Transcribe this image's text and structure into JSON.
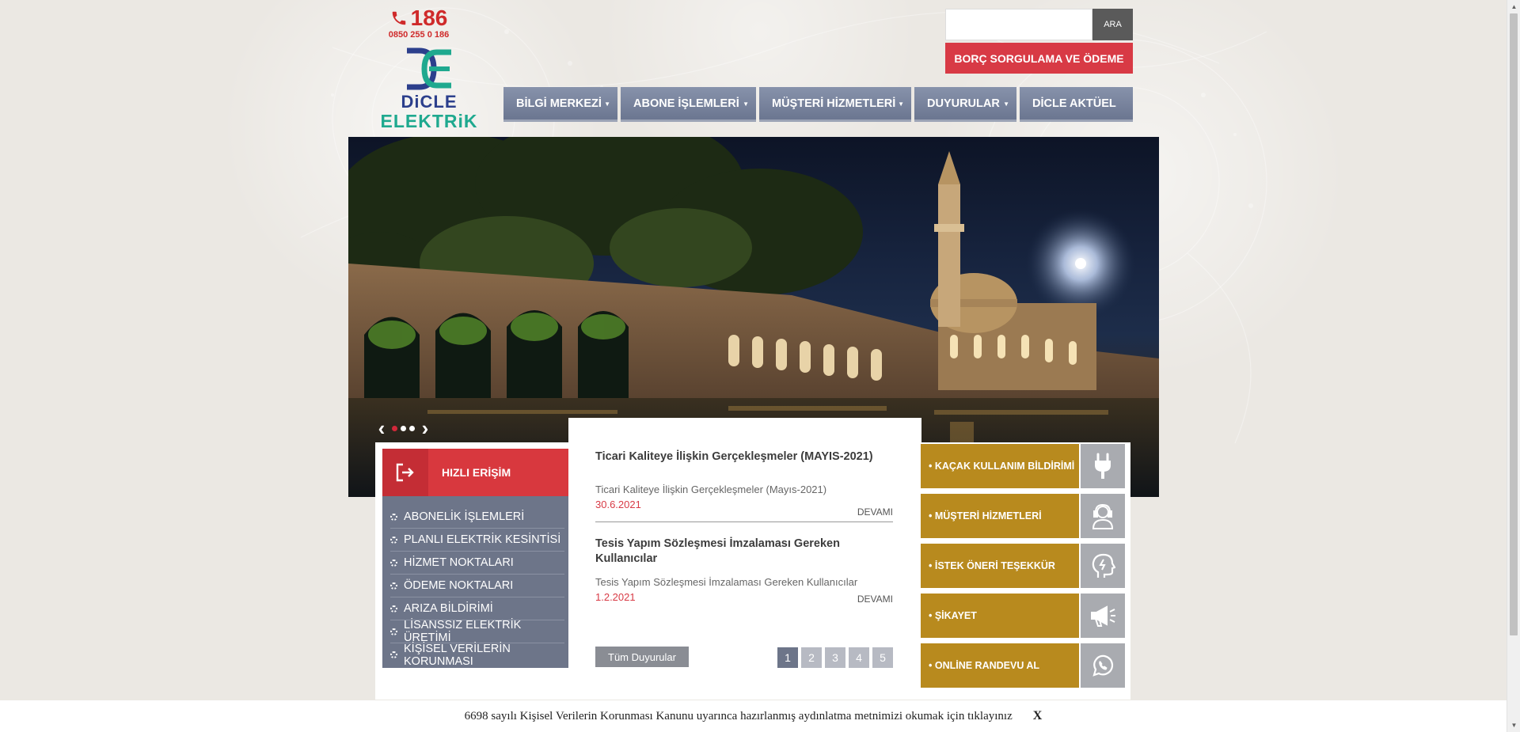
{
  "header": {
    "phone_short": "186",
    "phone_long": "0850 255 0 186",
    "logo_line1": "DiCLE",
    "logo_line2": "ELEKTRiK",
    "search_placeholder": "",
    "search_button": "ARA",
    "borc_button": "BORÇ SORGULAMA VE ÖDEME"
  },
  "nav": {
    "items": [
      {
        "label": "BİLGİ MERKEZİ",
        "has_dropdown": true
      },
      {
        "label": "ABONE İŞLEMLERİ",
        "has_dropdown": true
      },
      {
        "label": "MÜŞTERİ HİZMETLERİ",
        "has_dropdown": true
      },
      {
        "label": "DUYURULAR",
        "has_dropdown": true
      },
      {
        "label": "DİCLE AKTÜEL",
        "has_dropdown": false
      }
    ]
  },
  "slider": {
    "slides": 3,
    "active_slide": 1
  },
  "quick_access": {
    "title": "HIZLI ERİŞİM",
    "items": [
      "ABONELİK İŞLEMLERİ",
      "PLANLI ELEKTRİK KESİNTİSİ",
      "HİZMET NOKTALARI",
      "ÖDEME NOKTALARI",
      "ARIZA BİLDİRİMİ",
      "LİSANSSIZ ELEKTRİK ÜRETİMİ",
      "KİŞİSEL VERİLERİN KORUNMASI"
    ]
  },
  "news": {
    "items": [
      {
        "title": "Ticari Kaliteye İlişkin Gerçekleşmeler (MAYIS-2021)",
        "desc": "Ticari Kaliteye İlişkin Gerçekleşmeler (Mayıs-2021)",
        "date": "30.6.2021",
        "more": "DEVAMI"
      },
      {
        "title": "Tesis Yapım Sözleşmesi İmzalaması Gereken Kullanıcılar",
        "desc": "Tesis Yapım Sözleşmesi İmzalaması Gereken Kullanıcılar",
        "date": "1.2.2021",
        "more": "DEVAMI"
      }
    ],
    "all_button": "Tüm Duyurular",
    "pages": [
      "1",
      "2",
      "3",
      "4",
      "5"
    ],
    "active_page": "1"
  },
  "side_links": [
    {
      "label": "• KAÇAK KULLANIM BİLDİRİMİ",
      "icon": "plug-icon"
    },
    {
      "label": "• MÜŞTERİ HİZMETLERİ",
      "icon": "customer-service-icon"
    },
    {
      "label": "• İSTEK ÖNERİ TEŞEKKÜR",
      "icon": "idea-head-icon"
    },
    {
      "label": "• ŞİKAYET",
      "icon": "megaphone-icon"
    },
    {
      "label": "• ONLİNE RANDEVU AL",
      "icon": "whatsapp-icon"
    }
  ],
  "cookie_bar": {
    "text": "6698 sayılı Kişisel Verilerin Korunması Kanunu uyarınca hazırlanmış aydınlatma metnimizi okumak için tıklayınız",
    "close": "X"
  },
  "colors": {
    "accent_red": "#d83a45",
    "nav_blue": "#6b7690",
    "gold": "#b88a1e",
    "logo_blue": "#2c3f8c",
    "logo_teal": "#1fa98f"
  }
}
